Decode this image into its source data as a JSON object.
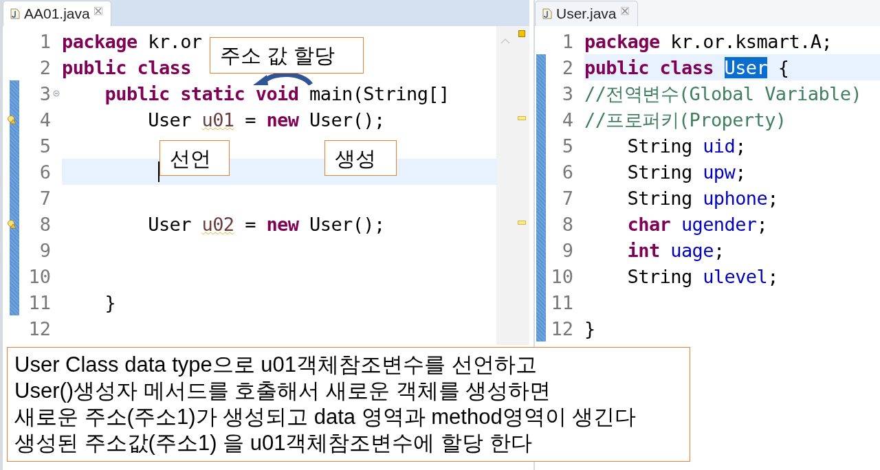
{
  "editors": [
    {
      "tab": {
        "label": "AA01.java",
        "selected": true
      },
      "overview_ruler": true,
      "lines": [
        {
          "number": "1",
          "changed": false,
          "current": false,
          "warning": false,
          "fold": false,
          "cursor": false,
          "tokens": [
            {
              "kind": "keyword",
              "text": "package"
            },
            {
              "kind": "plain",
              "text": " kr.or"
            }
          ]
        },
        {
          "number": "2",
          "changed": false,
          "current": false,
          "warning": false,
          "fold": false,
          "cursor": false,
          "tokens": [
            {
              "kind": "keyword",
              "text": "public class"
            }
          ]
        },
        {
          "number": "3",
          "changed": true,
          "current": false,
          "warning": false,
          "fold": true,
          "cursor": false,
          "tokens": [
            {
              "kind": "keyword",
              "text": "    public static void"
            },
            {
              "kind": "plain",
              "text": " main(String[]"
            }
          ]
        },
        {
          "number": "4",
          "changed": true,
          "current": false,
          "warning": true,
          "fold": false,
          "cursor": false,
          "tokens": [
            {
              "kind": "plain",
              "text": "        User "
            },
            {
              "kind": "local",
              "text": "u01",
              "underline": true
            },
            {
              "kind": "plain",
              "text": " = "
            },
            {
              "kind": "keyword",
              "text": "new"
            },
            {
              "kind": "plain",
              "text": " User();"
            }
          ]
        },
        {
          "number": "5",
          "changed": true,
          "current": false,
          "warning": false,
          "fold": false,
          "cursor": false
        },
        {
          "number": "6",
          "changed": true,
          "current": true,
          "warning": false,
          "fold": false,
          "cursor": true
        },
        {
          "number": "7",
          "changed": true,
          "current": false,
          "warning": false,
          "fold": false,
          "cursor": false
        },
        {
          "number": "8",
          "changed": true,
          "current": false,
          "warning": true,
          "fold": false,
          "cursor": false,
          "tokens": [
            {
              "kind": "plain",
              "text": "        User "
            },
            {
              "kind": "local",
              "text": "u02",
              "underline": true
            },
            {
              "kind": "plain",
              "text": " = "
            },
            {
              "kind": "keyword",
              "text": "new"
            },
            {
              "kind": "plain",
              "text": " User();"
            }
          ]
        },
        {
          "number": "9",
          "changed": true,
          "current": false,
          "warning": false,
          "fold": false,
          "cursor": false
        },
        {
          "number": "10",
          "changed": true,
          "current": false,
          "warning": false,
          "fold": false,
          "cursor": false
        },
        {
          "number": "11",
          "changed": true,
          "current": false,
          "warning": false,
          "fold": false,
          "cursor": false,
          "tokens": [
            {
              "kind": "plain",
              "text": "    }"
            }
          ]
        },
        {
          "number": "12",
          "changed": false,
          "current": false,
          "warning": false,
          "fold": false,
          "cursor": false
        }
      ]
    },
    {
      "tab": {
        "label": "User.java",
        "selected": false
      },
      "overview_ruler": false,
      "lines": [
        {
          "number": "1",
          "changed": false,
          "current": false,
          "warning": false,
          "fold": false,
          "cursor": false,
          "tokens": [
            {
              "kind": "keyword",
              "text": "package"
            },
            {
              "kind": "plain",
              "text": " kr.or.ksmart.A;"
            }
          ]
        },
        {
          "number": "2",
          "changed": true,
          "current": true,
          "warning": false,
          "fold": false,
          "cursor": false,
          "tokens": [
            {
              "kind": "keyword",
              "text": "public class "
            },
            {
              "kind": "plain",
              "text": "User",
              "selected": true
            },
            {
              "kind": "plain",
              "text": " {"
            }
          ]
        },
        {
          "number": "3",
          "changed": true,
          "current": false,
          "warning": false,
          "fold": false,
          "cursor": false,
          "tokens": [
            {
              "kind": "comment",
              "text": "//전역변수(Global Variable)"
            }
          ]
        },
        {
          "number": "4",
          "changed": true,
          "current": false,
          "warning": false,
          "fold": false,
          "cursor": false,
          "tokens": [
            {
              "kind": "comment",
              "text": "//프로퍼키(Property)"
            }
          ]
        },
        {
          "number": "5",
          "changed": true,
          "current": false,
          "warning": false,
          "fold": false,
          "cursor": false,
          "tokens": [
            {
              "kind": "plain",
              "text": "    String "
            },
            {
              "kind": "field",
              "text": "uid"
            },
            {
              "kind": "plain",
              "text": ";"
            }
          ]
        },
        {
          "number": "6",
          "changed": true,
          "current": false,
          "warning": false,
          "fold": false,
          "cursor": false,
          "tokens": [
            {
              "kind": "plain",
              "text": "    String "
            },
            {
              "kind": "field",
              "text": "upw"
            },
            {
              "kind": "plain",
              "text": ";"
            }
          ]
        },
        {
          "number": "7",
          "changed": true,
          "current": false,
          "warning": false,
          "fold": false,
          "cursor": false,
          "tokens": [
            {
              "kind": "plain",
              "text": "    String "
            },
            {
              "kind": "field",
              "text": "uphone"
            },
            {
              "kind": "plain",
              "text": ";"
            }
          ]
        },
        {
          "number": "8",
          "changed": true,
          "current": false,
          "warning": false,
          "fold": false,
          "cursor": false,
          "tokens": [
            {
              "kind": "keyword",
              "text": "    char "
            },
            {
              "kind": "field",
              "text": "ugender"
            },
            {
              "kind": "plain",
              "text": ";"
            }
          ]
        },
        {
          "number": "9",
          "changed": true,
          "current": false,
          "warning": false,
          "fold": false,
          "cursor": false,
          "tokens": [
            {
              "kind": "keyword",
              "text": "    int "
            },
            {
              "kind": "field",
              "text": "uage"
            },
            {
              "kind": "plain",
              "text": ";"
            }
          ]
        },
        {
          "number": "10",
          "changed": true,
          "current": false,
          "warning": false,
          "fold": false,
          "cursor": false,
          "tokens": [
            {
              "kind": "plain",
              "text": "    String "
            },
            {
              "kind": "field",
              "text": "ulevel"
            },
            {
              "kind": "plain",
              "text": ";"
            }
          ]
        },
        {
          "number": "11",
          "changed": true,
          "current": false,
          "warning": false,
          "fold": false,
          "cursor": false
        },
        {
          "number": "12",
          "changed": true,
          "current": false,
          "warning": false,
          "fold": false,
          "cursor": false,
          "tokens": [
            {
              "kind": "plain",
              "text": "}"
            }
          ]
        }
      ]
    }
  ],
  "callouts": [
    {
      "kind": "assign",
      "text": "주소 값 할당"
    },
    {
      "kind": "declare",
      "text": "선언"
    },
    {
      "kind": "create",
      "text": "생성"
    }
  ],
  "note": {
    "lines": [
      "User Class data type으로 u01객체참조변수를 선언하고",
      "User()생성자 메서드를 호출해서 새로운 객체를 생성하면",
      "새로운 주소(주소1)가 생성되고 data 영역과 method영역이 생긴다",
      "생성된 주소값(주소1) 을 u01객체참조변수에 할당 한다"
    ]
  }
}
